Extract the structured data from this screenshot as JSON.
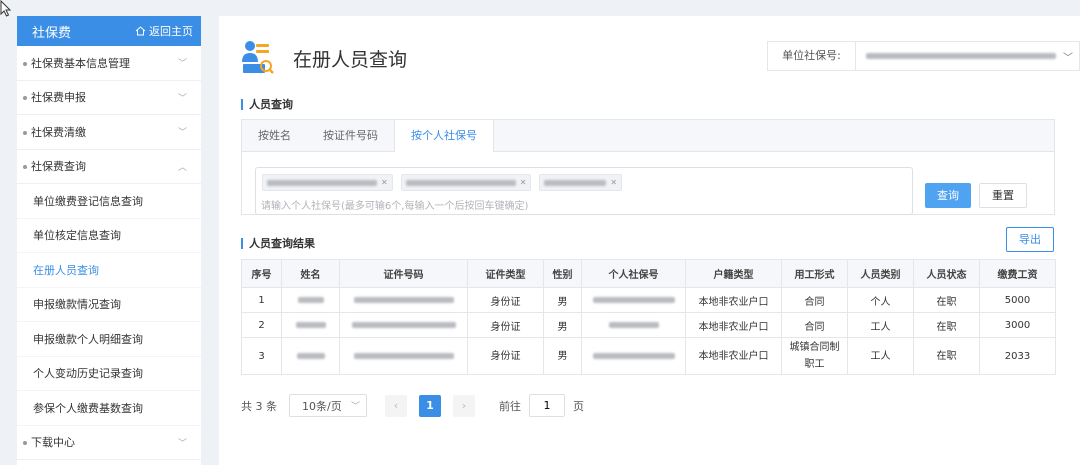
{
  "sidebar": {
    "title": "社保费",
    "home_label": "返回主页",
    "items": [
      {
        "label": "社保费基本信息管理",
        "chevron": "down"
      },
      {
        "label": "社保费申报",
        "chevron": "down"
      },
      {
        "label": "社保费清缴",
        "chevron": "down"
      },
      {
        "label": "社保费查询",
        "chevron": "up"
      }
    ],
    "sub_items": [
      {
        "label": "单位缴费登记信息查询"
      },
      {
        "label": "单位核定信息查询"
      },
      {
        "label": "在册人员查询",
        "active": true
      },
      {
        "label": "申报缴款情况查询"
      },
      {
        "label": "申报缴款个人明细查询"
      },
      {
        "label": "个人变动历史记录查询"
      },
      {
        "label": "参保个人缴费基数查询"
      }
    ],
    "bottom_item": {
      "label": "下载中心",
      "chevron": "down"
    }
  },
  "header": {
    "title": "在册人员查询",
    "unit_label": "单位社保号:"
  },
  "search": {
    "section_title": "人员查询",
    "tabs": [
      "按姓名",
      "按证件号码",
      "按个人社保号"
    ],
    "active_tab": 2,
    "placeholder": "请输入个人社保号(最多可输6个,每输入一个后按回车键确定)",
    "query_label": "查询",
    "reset_label": "重置"
  },
  "results": {
    "section_title": "人员查询结果",
    "export_label": "导出",
    "columns": [
      "序号",
      "姓名",
      "证件号码",
      "证件类型",
      "性别",
      "个人社保号",
      "户籍类型",
      "用工形式",
      "人员类别",
      "人员状态",
      "缴费工资"
    ],
    "rows": [
      {
        "no": "1",
        "id_type": "身份证",
        "gender": "男",
        "household": "本地非农业户口",
        "employment": "合同",
        "category": "个人",
        "status": "在职",
        "wage": "5000"
      },
      {
        "no": "2",
        "id_type": "身份证",
        "gender": "男",
        "household": "本地非农业户口",
        "employment": "合同",
        "category": "工人",
        "status": "在职",
        "wage": "3000"
      },
      {
        "no": "3",
        "id_type": "身份证",
        "gender": "男",
        "household": "本地非农业户口",
        "employment": "城镇合同制职工",
        "category": "工人",
        "status": "在职",
        "wage": "2033"
      }
    ]
  },
  "pagination": {
    "total": "共 3 条",
    "page_size": "10条/页",
    "current_page": "1",
    "goto_label": "前往",
    "goto_value": "1",
    "page_suffix": "页"
  },
  "colors": {
    "accent": "#3a8ee6",
    "query_button": "#4fa3f0"
  }
}
